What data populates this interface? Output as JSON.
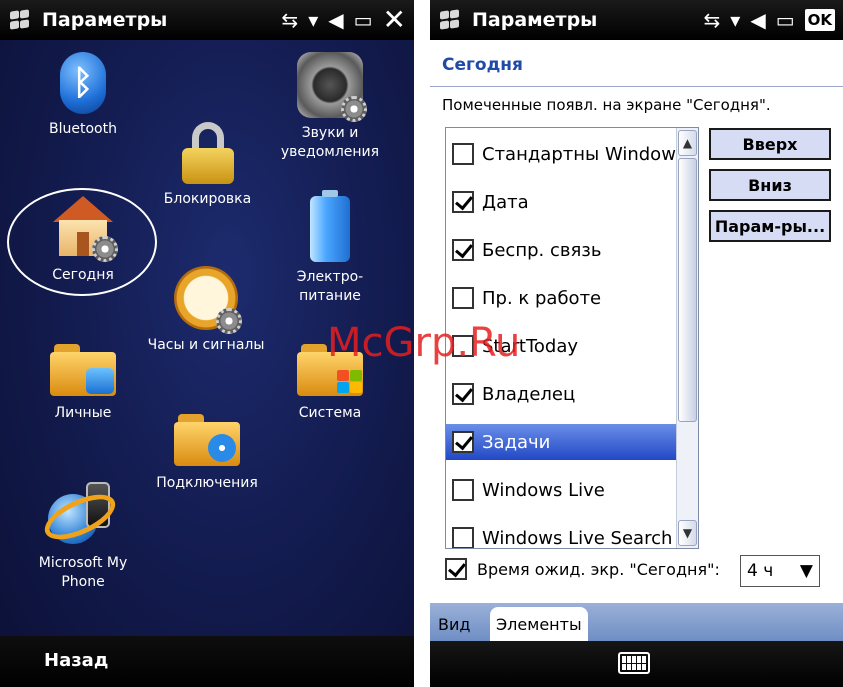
{
  "left_screen": {
    "title": "Параметры",
    "back_label": "Назад",
    "items": {
      "bluetooth": "Bluetooth",
      "sounds": [
        "Звуки и",
        "уведомления"
      ],
      "lock": "Блокировка",
      "today": "Сегодня",
      "power": [
        "Электро-",
        "питание"
      ],
      "clock": "Часы и сигналы",
      "personal": "Личные",
      "system": "Система",
      "connections": "Подключения",
      "myphone": [
        "Microsoft My",
        "Phone"
      ]
    },
    "colors": {
      "background": "#141d52",
      "text": "#ffffff"
    }
  },
  "right_screen": {
    "title": "Параметры",
    "ok_label": "OK",
    "heading": "Сегодня",
    "instruction": "Помеченные появл. на экране \"Сегодня\".",
    "items": [
      {
        "label": "Стандартны Window",
        "checked": false,
        "selected": false
      },
      {
        "label": "Дата",
        "checked": true,
        "selected": false
      },
      {
        "label": "Беспр. связь",
        "checked": true,
        "selected": false
      },
      {
        "label": "Пр. к работе",
        "checked": false,
        "selected": false
      },
      {
        "label": "StartToday",
        "checked": false,
        "selected": false
      },
      {
        "label": "Владелец",
        "checked": true,
        "selected": false
      },
      {
        "label": "Задачи",
        "checked": true,
        "selected": true
      },
      {
        "label": "Windows Live",
        "checked": false,
        "selected": false
      },
      {
        "label": "Windows Live Search",
        "checked": false,
        "selected": false
      }
    ],
    "buttons": {
      "up": "Вверх",
      "down": "Вниз",
      "options": "Парам-ры..."
    },
    "timeout": {
      "label": "Время ожид. экр. \"Сегодня\":",
      "checked": true,
      "value": "4 ч"
    },
    "tabs": {
      "view": "Вид",
      "items": "Элементы"
    },
    "colors": {
      "heading": "#1f4aa8",
      "selected_row": "#2248c6",
      "button_bg": "#d7dcf5"
    }
  },
  "watermark": "McGrp.Ru"
}
